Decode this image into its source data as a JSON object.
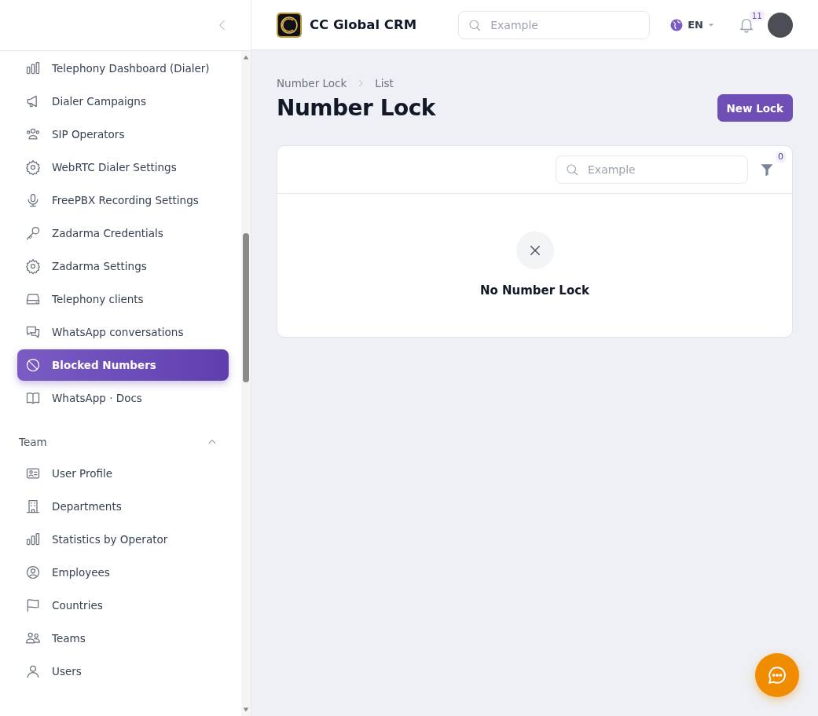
{
  "sidebar": {
    "items": [
      {
        "label": "Telephony Dashboard (Dialer)",
        "selected": false
      },
      {
        "label": "Dialer Campaigns",
        "selected": false
      },
      {
        "label": "SIP Operators",
        "selected": false
      },
      {
        "label": "WebRTC Dialer Settings",
        "selected": false
      },
      {
        "label": "FreePBX Recording Settings",
        "selected": false
      },
      {
        "label": "Zadarma Credentials",
        "selected": false
      },
      {
        "label": "Zadarma Settings",
        "selected": false
      },
      {
        "label": "Telephony clients",
        "selected": false
      },
      {
        "label": "WhatsApp conversations",
        "selected": false
      },
      {
        "label": "Blocked Numbers",
        "selected": true
      },
      {
        "label": "WhatsApp · Docs",
        "selected": false
      }
    ],
    "sections": [
      {
        "title": "Team",
        "expanded": true,
        "items": [
          {
            "label": "User Profile",
            "selected": false
          },
          {
            "label": "Departments",
            "selected": false
          },
          {
            "label": "Statistics by Operator",
            "selected": false
          },
          {
            "label": "Employees",
            "selected": false
          },
          {
            "label": "Countries",
            "selected": false
          },
          {
            "label": "Teams",
            "selected": false
          },
          {
            "label": "Users",
            "selected": false
          }
        ]
      }
    ]
  },
  "topbar": {
    "brand": "CC Global CRM",
    "search": {
      "placeholder": "Example"
    },
    "language": "EN",
    "notification_count": "11"
  },
  "breadcrumb": [
    "Number Lock",
    "List"
  ],
  "page_title": "Number Lock",
  "new_button": "New Lock",
  "table": {
    "search": {
      "placeholder": "Example"
    },
    "filter_count": "0",
    "empty_message": "No Number Lock"
  }
}
